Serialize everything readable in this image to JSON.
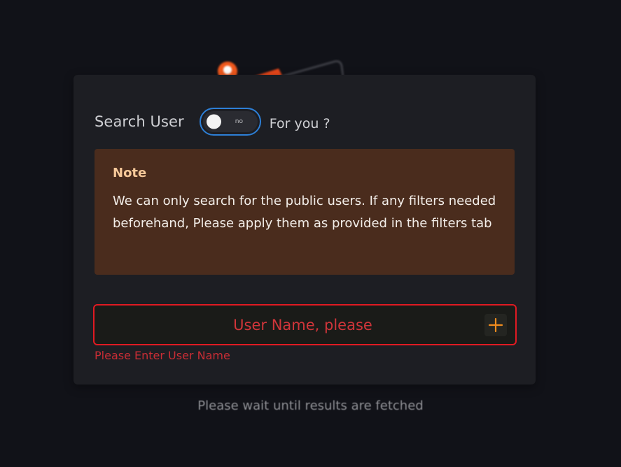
{
  "search_panel": {
    "title": "Search User",
    "toggle": {
      "label": "no",
      "state": "off"
    },
    "for_you_label": "For you ?"
  },
  "note": {
    "title": "Note",
    "body": "We can only search for the public users. If any filters needed beforehand, Please apply them as provided in the filters tab"
  },
  "user_input": {
    "value": "",
    "placeholder": "User Name, please",
    "add_icon": "plus-icon",
    "error_message": "Please Enter User Name"
  },
  "status": {
    "message": "Please wait until results are fetched"
  },
  "colors": {
    "background": "#111218",
    "card": "#1d1e23",
    "note_background": "#4a2c1d",
    "note_title": "#f7c99a",
    "toggle_border": "#2d7fd6",
    "error": "#e01a22",
    "accent_orange": "#f08c1e"
  }
}
